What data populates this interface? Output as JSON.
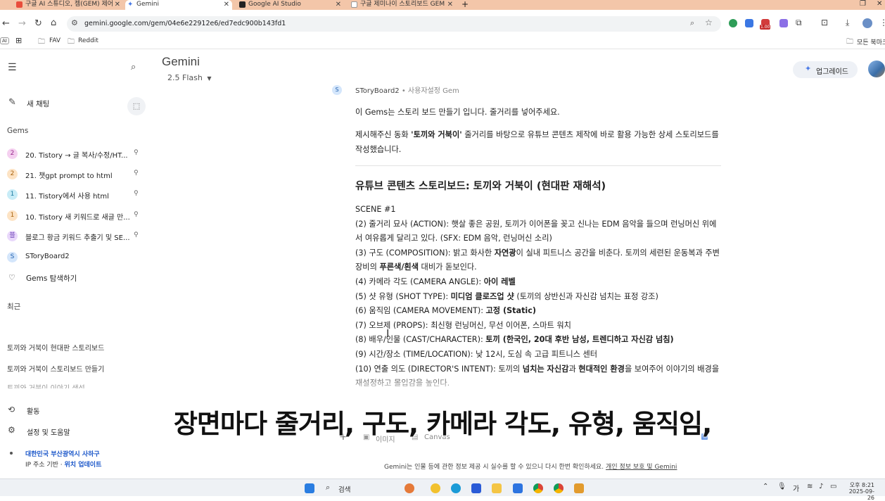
{
  "browser": {
    "tabs": [
      {
        "label": "구글 AI 스튜디오, 젬(GEM) 제어",
        "active": false
      },
      {
        "label": "Gemini",
        "active": true
      },
      {
        "label": "Google AI Studio",
        "active": false
      },
      {
        "label": "구글 제미나이 스토리보드 GEM",
        "active": false
      }
    ],
    "new_tab": "+",
    "url": "gemini.google.com/gem/04e6e22912e6/ed7edc900b143fd1",
    "ext_badge": "1.00",
    "bookmarks": {
      "ai_badge": "AI",
      "fav": "FAV",
      "reddit": "Reddit",
      "all_bookmarks": "모든 북마크"
    }
  },
  "sidebar": {
    "new_chat": "새 채팅",
    "gems_heading": "Gems",
    "gems": [
      {
        "badge": "2",
        "label": "20. Tistory → 글 복사/수정/HT...",
        "color": "#f5d0f0",
        "fg": "#9a2b8d"
      },
      {
        "badge": "2",
        "label": "21. 챗gpt prompt to html",
        "color": "#fde3c4",
        "fg": "#a8620e"
      },
      {
        "badge": "1",
        "label": "11. Tistory에서 사용 html",
        "color": "#c8ecf7",
        "fg": "#1b7aa0"
      },
      {
        "badge": "1",
        "label": "10. Tistory 새 키워드로 새글 만...",
        "color": "#fde3c4",
        "fg": "#a8620e"
      },
      {
        "badge": "블",
        "label": "블로그 황금 키워드 추출기 및 SE...",
        "color": "#e9d8fb",
        "fg": "#6a3fb5"
      },
      {
        "badge": "S",
        "label": "SToryBoard2",
        "color": "#d4e6fb",
        "fg": "#1f5fae"
      }
    ],
    "explore_gems": "Gems 탐색하기",
    "recent_heading": "최근",
    "recent": [
      "토끼와 거북이 현대판 스토리보드",
      "토끼와 거북이 스토리보드 만들기",
      "토끼와 거북이 이야기 생성"
    ],
    "activity": "활동",
    "settings": "설정 및 도움말",
    "location": "대한민국 부산광역시 사하구",
    "ip_basis": "IP 주소 기반",
    "update_location": "위치 업데이트"
  },
  "main": {
    "title": "Gemini",
    "model": "2.5 Flash",
    "upgrade": "업그레이드",
    "sender": "SToryBoard2",
    "sender_tag": "• 사용자설정 Gem",
    "sender_badge": "S",
    "user_msg": "이 Gems는 스토리 보드 만들기 입니다. 줄거리를 넣어주세요.",
    "intro_pre": "제시해주신 동화 ",
    "intro_bold": "'토끼와 거북이'",
    "intro_post": " 줄거리를 바탕으로 유튜브 콘텐츠 제작에 바로 활용 가능한 상세 스토리보드를 작성했습니다.",
    "heading": "유튜브 콘텐츠 스토리보드: 토끼와 거북이 (현대판 재해석)",
    "scene": "SCENE #1",
    "l2": "(2) 줄거리 묘사 (ACTION): 햇살 좋은 공원, 토끼가 이어폰을 꽂고 신나는 EDM 음악을 들으며 런닝머신 위에서 여유롭게 달리고 있다. (SFX: EDM 음악, 런닝머신 소리)",
    "l3a": "(3) 구도 (COMPOSITION): 밝고 화사한 ",
    "l3b": "자연광",
    "l3c": "이 실내 피트니스 공간을 비춘다. 토끼의 세련된 운동복과 주변 장비의 ",
    "l3d": "푸른색/흰색",
    "l3e": " 대비가 돋보인다.",
    "l4a": "(4) 카메라 각도 (CAMERA ANGLE): ",
    "l4b": "아이 레벨",
    "l5a": "(5) 샷 유형 (SHOT TYPE): ",
    "l5b": "미디엄 클로즈업 샷",
    "l5c": " (토끼의 상반신과 자신감 넘치는 표정 강조)",
    "l6a": "(6) 움직임 (CAMERA MOVEMENT): ",
    "l6b": "고정 (Static)",
    "l7": "(7) 오브제 (PROPS): 최신형 런닝머신, 무선 이어폰, 스마트 워치",
    "l8a": "(8) 배우/인물 (CAST/CHARACTER): ",
    "l8b": "토끼 (한국인, 20대 후반 남성, 트렌디하고 자신감 넘침)",
    "l9": "(9) 시간/장소 (TIME/LOCATION): 낮 12시, 도심 속 고급 피트니스 센터",
    "l10a": "(10) 연출 의도 (DIRECTOR'S INTENT): 토끼의 ",
    "l10b": "넘치는 자신감",
    "l10c": "과 ",
    "l10d": "현대적인 환경",
    "l10e": "을 보여주어 이야기의 배경을 재설정하고 몰입감을 높인다.",
    "caption": "장면마다 줄거리, 구도, 카메라 각도, 유형, 움직임,",
    "input_image": "이미지",
    "input_canvas": "Canvas",
    "disclaimer": "Gemini는 인물 등에 관한 정보 제공 시 실수를 할 수 있으니 다시 한번 확인하세요.",
    "disclaimer_link": "개인 정보 보호 및 Gemini"
  },
  "taskbar": {
    "search": "검색",
    "ime": "가",
    "time": "오후 8:21",
    "date": "2025-09-26"
  }
}
